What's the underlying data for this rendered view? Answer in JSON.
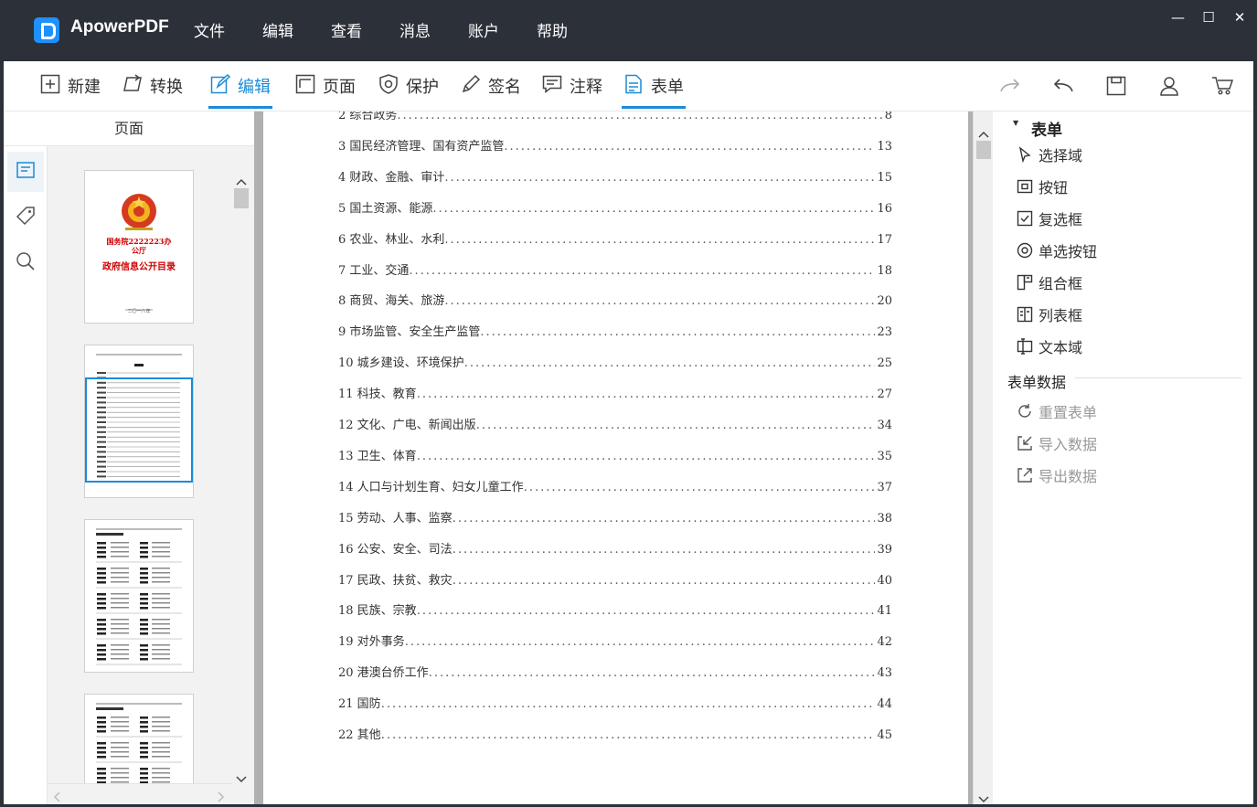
{
  "app": {
    "title": "ApowerPDF"
  },
  "menu": [
    "文件",
    "编辑",
    "查看",
    "消息",
    "账户",
    "帮助"
  ],
  "window_controls": {
    "minimize": "—",
    "maximize": "☐",
    "close": "✕"
  },
  "toolbar": {
    "tools": [
      {
        "label": "新建",
        "icon": "plus-box-icon"
      },
      {
        "label": "转换",
        "icon": "convert-icon"
      },
      {
        "label": "编辑",
        "icon": "edit-icon",
        "active": true
      },
      {
        "label": "页面",
        "icon": "page-icon"
      },
      {
        "label": "保护",
        "icon": "shield-icon"
      },
      {
        "label": "签名",
        "icon": "pen-icon"
      },
      {
        "label": "注释",
        "icon": "comment-icon"
      },
      {
        "label": "表单",
        "icon": "form-icon",
        "underlined": true
      }
    ],
    "right": [
      "redo-icon",
      "undo-icon",
      "save-icon",
      "user-icon",
      "cart-icon"
    ]
  },
  "left_panel": {
    "header": "页面",
    "tabs": [
      "thumbnails-icon",
      "bookmark-tag-icon",
      "search-icon"
    ],
    "cover_page": {
      "title_line1": "国务院2222223办公厅",
      "title_line2": "政府信息公开目录",
      "footer": "二〇一八年"
    }
  },
  "document": {
    "toc": [
      {
        "label": "2 综合政务",
        "page": "8"
      },
      {
        "label": "3 国民经济管理、国有资产监管",
        "page": "13"
      },
      {
        "label": "4 财政、金融、审计",
        "page": "15"
      },
      {
        "label": "5 国土资源、能源",
        "page": "16"
      },
      {
        "label": "6 农业、林业、水利",
        "page": "17"
      },
      {
        "label": "7 工业、交通",
        "page": "18"
      },
      {
        "label": "8 商贸、海关、旅游",
        "page": "20"
      },
      {
        "label": "9 市场监管、安全生产监管",
        "page": "23"
      },
      {
        "label": "10 城乡建设、环境保护",
        "page": "25"
      },
      {
        "label": "11 科技、教育",
        "page": "27"
      },
      {
        "label": "12 文化、广电、新闻出版",
        "page": "34"
      },
      {
        "label": "13 卫生、体育",
        "page": "35"
      },
      {
        "label": "14 人口与计划生育、妇女儿童工作",
        "page": "37"
      },
      {
        "label": "15 劳动、人事、监察",
        "page": "38"
      },
      {
        "label": "16 公安、安全、司法",
        "page": "39"
      },
      {
        "label": "17 民政、扶贫、救灾",
        "page": "40"
      },
      {
        "label": "18 民族、宗教",
        "page": "41"
      },
      {
        "label": "19 对外事务",
        "page": "42"
      },
      {
        "label": "20 港澳台侨工作",
        "page": "43"
      },
      {
        "label": "21 国防",
        "page": "44"
      },
      {
        "label": "22 其他",
        "page": "45"
      }
    ]
  },
  "right_panel": {
    "title": "表单",
    "items": [
      {
        "label": "选择域",
        "icon": "cursor-icon"
      },
      {
        "label": "按钮",
        "icon": "button-icon"
      },
      {
        "label": "复选框",
        "icon": "checkbox-icon"
      },
      {
        "label": "单选按钮",
        "icon": "radio-icon"
      },
      {
        "label": "组合框",
        "icon": "combobox-icon"
      },
      {
        "label": "列表框",
        "icon": "listbox-icon"
      },
      {
        "label": "文本域",
        "icon": "textfield-icon"
      }
    ],
    "data_section": "表单数据",
    "data_items": [
      {
        "label": "重置表单",
        "icon": "reset-icon"
      },
      {
        "label": "导入数据",
        "icon": "import-icon"
      },
      {
        "label": "导出数据",
        "icon": "export-icon"
      }
    ]
  }
}
